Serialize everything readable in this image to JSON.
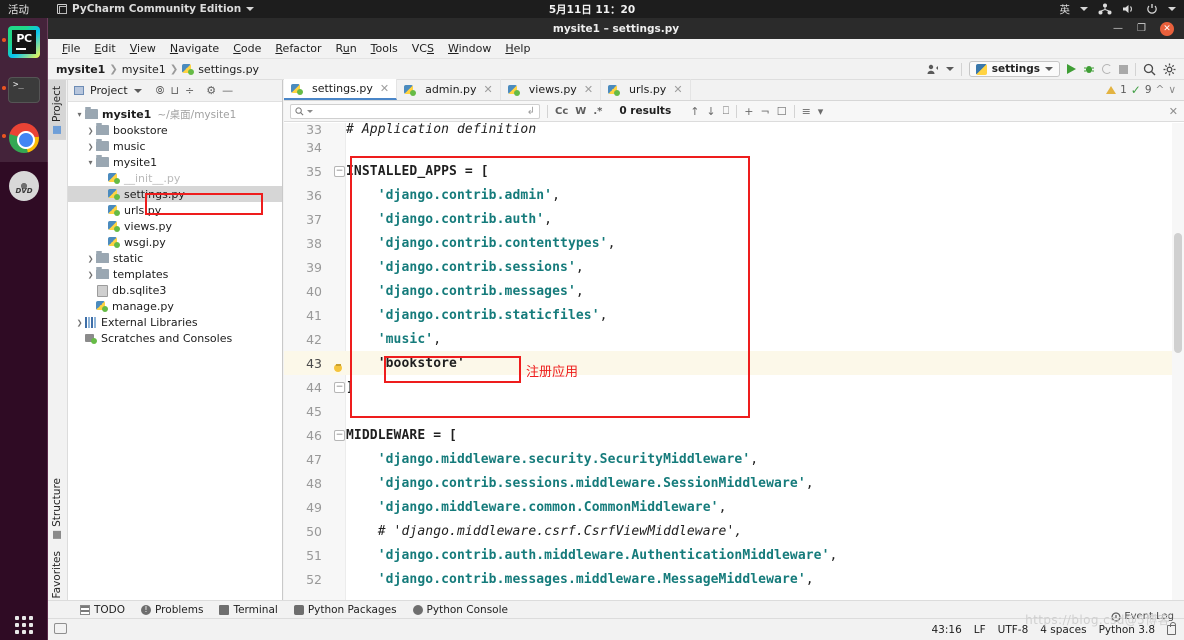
{
  "desktop": {
    "activities": "活动",
    "app_name": "PyCharm Community Edition",
    "clock": "5月11日  11：20",
    "input_method": "英",
    "icons": [
      "network-icon",
      "volume-icon",
      "power-icon",
      "chevron-down-icon"
    ],
    "dock": [
      {
        "name": "pycharm",
        "label": "PyCharm",
        "running": true
      },
      {
        "name": "terminal",
        "label": "Terminal",
        "running": true
      },
      {
        "name": "chrome",
        "label": "Google Chrome",
        "running": true
      },
      {
        "name": "dvd",
        "label": "DVD",
        "running": false
      }
    ],
    "show_apps_label": "Show Applications"
  },
  "window": {
    "title": "mysite1 – settings.py",
    "minimize": "—",
    "maximize": "❐",
    "close": "✕"
  },
  "menubar": [
    "File",
    "Edit",
    "View",
    "Navigate",
    "Code",
    "Refactor",
    "Run",
    "Tools",
    "VCS",
    "Window",
    "Help"
  ],
  "navbar": {
    "breadcrumbs": [
      "mysite1",
      "mysite1",
      "settings.py"
    ],
    "run_config": "settings",
    "buttons": [
      "profile-icon",
      "run-button",
      "debug-button",
      "coverage-button",
      "stop-button",
      "search-everywhere-button",
      "settings-gear-button"
    ]
  },
  "toolwindows": {
    "left_top": "Project",
    "left_bottom": [
      "Structure",
      "Favorites"
    ]
  },
  "project": {
    "header": "Project",
    "header_icons": [
      "collapse-icon",
      "expand-icon",
      "sort-icon",
      "settings-icon",
      "hide-icon"
    ],
    "tree": [
      {
        "label": "mysite1",
        "note": "~/桌面/mysite1",
        "depth": 0,
        "arrow": "open",
        "icon": "folder",
        "bold": true
      },
      {
        "label": "bookstore",
        "depth": 1,
        "arrow": "closed",
        "icon": "folder"
      },
      {
        "label": "music",
        "depth": 1,
        "arrow": "closed",
        "icon": "folder"
      },
      {
        "label": "mysite1",
        "depth": 1,
        "arrow": "open",
        "icon": "folder"
      },
      {
        "label": "__init__.py",
        "depth": 2,
        "arrow": "none",
        "icon": "python",
        "faded": true
      },
      {
        "label": "settings.py",
        "depth": 2,
        "arrow": "none",
        "icon": "python",
        "selected": true,
        "highlighted": true
      },
      {
        "label": "urls.py",
        "depth": 2,
        "arrow": "none",
        "icon": "python"
      },
      {
        "label": "views.py",
        "depth": 2,
        "arrow": "none",
        "icon": "python"
      },
      {
        "label": "wsgi.py",
        "depth": 2,
        "arrow": "none",
        "icon": "python"
      },
      {
        "label": "static",
        "depth": 1,
        "arrow": "closed",
        "icon": "folder"
      },
      {
        "label": "templates",
        "depth": 1,
        "arrow": "closed",
        "icon": "folder"
      },
      {
        "label": "db.sqlite3",
        "depth": 1,
        "arrow": "none",
        "icon": "db"
      },
      {
        "label": "manage.py",
        "depth": 1,
        "arrow": "none",
        "icon": "python"
      },
      {
        "label": "External Libraries",
        "depth": 0,
        "arrow": "closed",
        "icon": "library"
      },
      {
        "label": "Scratches and Consoles",
        "depth": 0,
        "arrow": "none",
        "icon": "scratches"
      }
    ]
  },
  "editor": {
    "tabs": [
      {
        "label": "settings.py",
        "active": true
      },
      {
        "label": "admin.py",
        "active": false
      },
      {
        "label": "views.py",
        "active": false
      },
      {
        "label": "urls.py",
        "active": false
      }
    ],
    "find": {
      "value": "",
      "placeholder": "",
      "options": [
        "Cc",
        "W",
        ".*"
      ],
      "results": "0 results",
      "icons": [
        "search-icon",
        "history-icon",
        "prev-match-icon",
        "next-match-icon",
        "select-all-icon",
        "add-selection-icon",
        "remove-selection-icon",
        "select-occurrence-icon",
        "filter-list-icon",
        "filter-icon",
        "close-icon"
      ]
    },
    "inspections": {
      "warnings": "1",
      "checks": "9"
    },
    "annotation": "注册应用",
    "lines": [
      {
        "n": "33",
        "tokens": [
          {
            "t": "cmt",
            "v": "# Application definition"
          }
        ],
        "indent": 0
      },
      {
        "n": "34",
        "tokens": [],
        "indent": 0
      },
      {
        "n": "35",
        "tokens": [
          {
            "t": "id",
            "v": "INSTALLED_APPS = ["
          }
        ],
        "fold": "minus"
      },
      {
        "n": "36",
        "tokens": [
          {
            "t": "str",
            "v": "    'django.contrib.admin'"
          },
          {
            "t": "punct",
            "v": ","
          }
        ]
      },
      {
        "n": "37",
        "tokens": [
          {
            "t": "str",
            "v": "    'django.contrib.auth'"
          },
          {
            "t": "punct",
            "v": ","
          }
        ]
      },
      {
        "n": "38",
        "tokens": [
          {
            "t": "str",
            "v": "    'django.contrib.contenttypes'"
          },
          {
            "t": "punct",
            "v": ","
          }
        ]
      },
      {
        "n": "39",
        "tokens": [
          {
            "t": "str",
            "v": "    'django.contrib.sessions'"
          },
          {
            "t": "punct",
            "v": ","
          }
        ]
      },
      {
        "n": "40",
        "tokens": [
          {
            "t": "str",
            "v": "    'django.contrib.messages'"
          },
          {
            "t": "punct",
            "v": ","
          }
        ]
      },
      {
        "n": "41",
        "tokens": [
          {
            "t": "str",
            "v": "    'django.contrib.staticfiles'"
          },
          {
            "t": "punct",
            "v": ","
          }
        ]
      },
      {
        "n": "42",
        "tokens": [
          {
            "t": "str",
            "v": "    'music'"
          },
          {
            "t": "punct",
            "v": ","
          }
        ]
      },
      {
        "n": "43",
        "tokens": [
          {
            "t": "str",
            "v": "    'bookstore'"
          }
        ],
        "current": true,
        "bulb": true
      },
      {
        "n": "44",
        "tokens": [
          {
            "t": "id",
            "v": "]"
          }
        ],
        "fold": "plus"
      },
      {
        "n": "45",
        "tokens": []
      },
      {
        "n": "46",
        "tokens": [
          {
            "t": "id",
            "v": "MIDDLEWARE = ["
          }
        ],
        "fold": "minus"
      },
      {
        "n": "47",
        "tokens": [
          {
            "t": "str",
            "v": "    'django.middleware.security.SecurityMiddleware'"
          },
          {
            "t": "punct",
            "v": ","
          }
        ]
      },
      {
        "n": "48",
        "tokens": [
          {
            "t": "str",
            "v": "    'django.contrib.sessions.middleware.SessionMiddleware'"
          },
          {
            "t": "punct",
            "v": ","
          }
        ]
      },
      {
        "n": "49",
        "tokens": [
          {
            "t": "str",
            "v": "    'django.middleware.common.CommonMiddleware'"
          },
          {
            "t": "punct",
            "v": ","
          }
        ]
      },
      {
        "n": "50",
        "tokens": [
          {
            "t": "cmt",
            "v": "    # 'django.middleware.csrf.CsrfViewMiddleware',"
          }
        ]
      },
      {
        "n": "51",
        "tokens": [
          {
            "t": "str",
            "v": "    'django.contrib.auth.middleware.AuthenticationMiddleware'"
          },
          {
            "t": "punct",
            "v": ","
          }
        ]
      },
      {
        "n": "52",
        "tokens": [
          {
            "t": "str",
            "v": "    'django.contrib.messages.middleware.MessageMiddleware'"
          },
          {
            "t": "punct",
            "v": ","
          }
        ]
      }
    ]
  },
  "bottom_tools": [
    {
      "label": "TODO",
      "icon": "todo-icon"
    },
    {
      "label": "Problems",
      "icon": "problems-icon"
    },
    {
      "label": "Terminal",
      "icon": "terminal-icon"
    },
    {
      "label": "Python Packages",
      "icon": "packages-icon"
    },
    {
      "label": "Python Console",
      "icon": "console-icon"
    }
  ],
  "statusbar": {
    "event_log": "Event Log",
    "caret": "43:16",
    "line_ending": "LF",
    "encoding": "UTF-8",
    "indent": "4 spaces",
    "interpreter": "Python 3.8",
    "lock_icon": "lock-icon"
  },
  "watermark": "https://blog.csd@5博客",
  "colors": {
    "accent": "#4a86c8",
    "string": "#157b7b",
    "comment": "#9a9a9a",
    "annotation_red": "#ee1d1d",
    "current_line": "#fcf8e9",
    "ubuntu_orange": "#e95420"
  }
}
